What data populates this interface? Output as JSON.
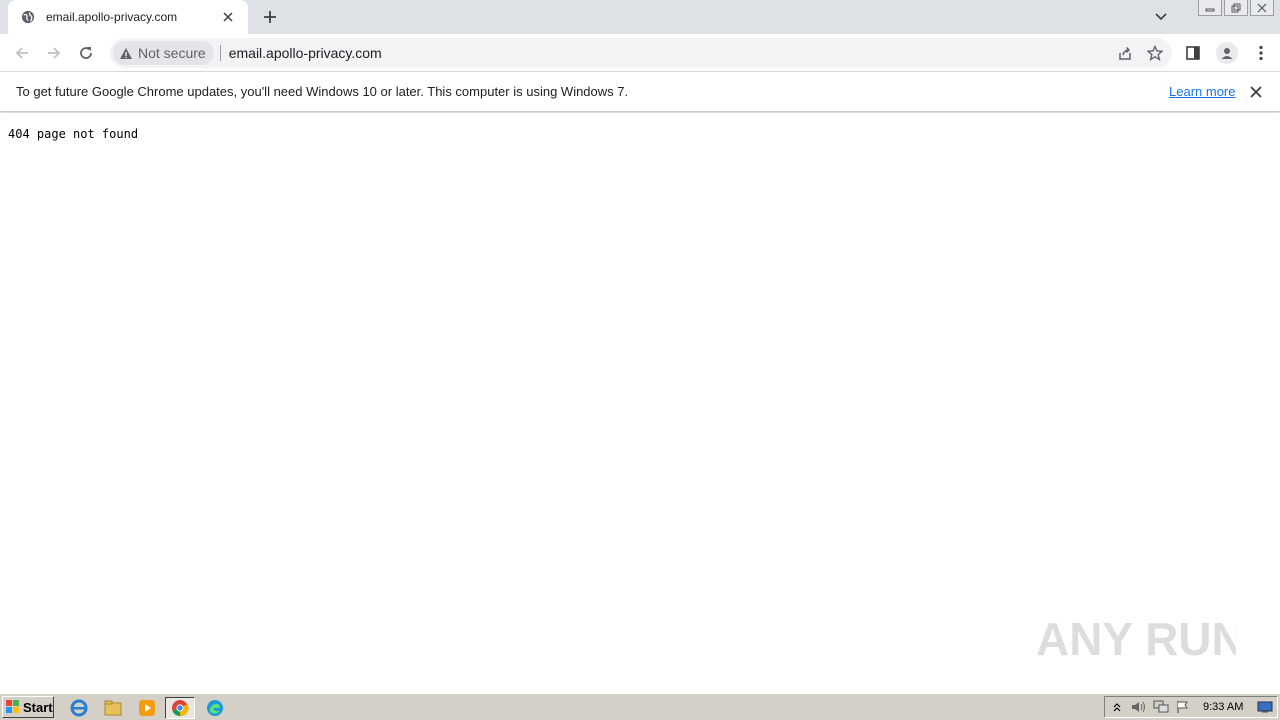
{
  "browser": {
    "tab": {
      "title": "email.apollo-privacy.com"
    },
    "omnibox": {
      "security_label": "Not secure",
      "url": "email.apollo-privacy.com"
    }
  },
  "infobar": {
    "message": "To get future Google Chrome updates, you'll need Windows 10 or later. This computer is using Windows 7.",
    "link_label": "Learn more"
  },
  "page": {
    "body_text": "404 page not found"
  },
  "watermark": {
    "text": "ANY RUN"
  },
  "taskbar": {
    "start_label": "Start",
    "clock": "9:33 AM"
  },
  "colors": {
    "tabstrip": "#dee1e6",
    "omnibox": "#f1f3f4",
    "link": "#1a73e8",
    "taskbar": "#d4d0c8"
  }
}
